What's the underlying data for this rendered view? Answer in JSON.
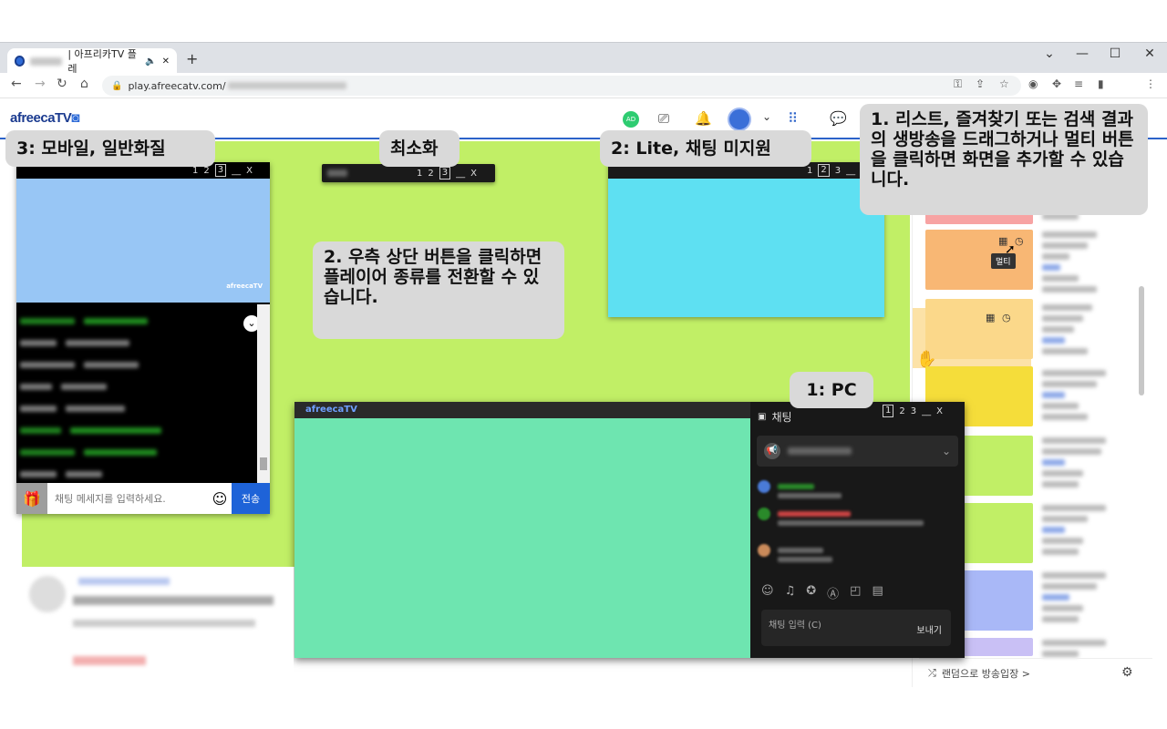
{
  "browser": {
    "tab_title": "| 아프리카TV 플레",
    "url": "play.afreecatv.com/",
    "new_tab": "+",
    "win_min": "—",
    "win_max": "☐",
    "win_close": "✕",
    "chevron": "⌄"
  },
  "site": {
    "logo": "afreecaTV",
    "ad_badge": "AD"
  },
  "callouts": {
    "mobile": "3: 모바일, 일반화질",
    "minimize": "최소화",
    "lite": "2: Lite, 채팅 미지원",
    "list_tip": "1. 리스트, 즐겨찾기 또는 검색 결과의 생방송을 드래그하거나 멀티 버튼을 클릭하면 화면을 추가할 수 있습니다.",
    "switch_tip": "2. 우측 상단 버튼을 클릭하면 플레이어 종류를 전환할 수 있습니다.",
    "pc": "1: PC"
  },
  "player_controls": {
    "btn1": "1",
    "btn2": "2",
    "btn3": "3",
    "minimize": "__",
    "close": "X"
  },
  "mobile_player": {
    "watermark": "afreecaTV",
    "chat_placeholder": "채팅 메세지를 입력하세요.",
    "send": "전송"
  },
  "pc_player": {
    "watermark": "afreecaTV",
    "chat_title": "채팅",
    "chat_input_placeholder": "채팅 입력 (C)",
    "send": "보내기"
  },
  "sidebar": {
    "multi_tooltip": "멀티",
    "random_entry": "랜덤으로 방송입장 >",
    "thumb_colors": [
      "#f7a3a3",
      "#f8b774",
      "#fbd88a",
      "#f5dd3a",
      "#c1ef66",
      "#c1ef66",
      "#a9b8f7",
      "#c9c0f5"
    ]
  }
}
